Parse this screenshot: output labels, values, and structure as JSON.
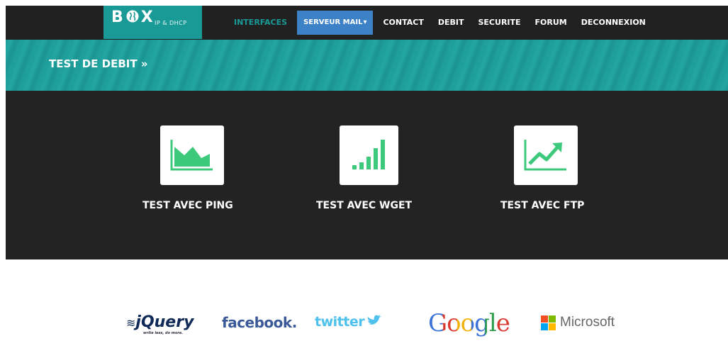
{
  "brand": {
    "name": "BOX",
    "subtitle": "IP & DHCP"
  },
  "nav": {
    "items": [
      "INTERFACES",
      "SERVEUR MAIL",
      "CONTACT",
      "DEBIT",
      "SECURITE",
      "FORUM",
      "DECONNEXION"
    ]
  },
  "banner": {
    "title": "TEST DE DEBIT »"
  },
  "tests": [
    {
      "label": "TEST AVEC PING",
      "icon": "area-chart-icon"
    },
    {
      "label": "TEST AVEC WGET",
      "icon": "signal-bars-icon"
    },
    {
      "label": "TEST AVEC FTP",
      "icon": "trend-up-chart-icon"
    }
  ],
  "logos": {
    "jquery": "jQuery",
    "jquery_tagline": "write less, do more.",
    "facebook": "facebook.",
    "twitter": "twitter",
    "google": "Google",
    "microsoft": "Microsoft"
  },
  "colors": {
    "accent": "#1a9a96",
    "nav_bg": "#212121",
    "dropdown_bg": "#3d82c6",
    "icon_green": "#3dc97b"
  }
}
